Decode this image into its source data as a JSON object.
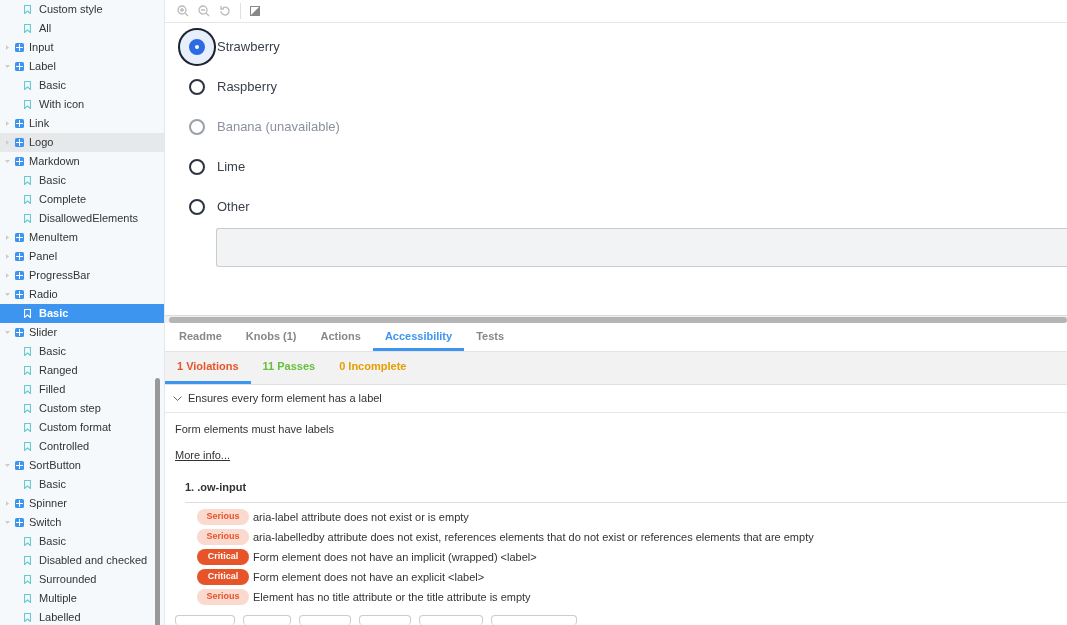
{
  "sidebar": {
    "items": [
      {
        "kind": "story",
        "label": "Custom style",
        "selected": false,
        "highlighted": false
      },
      {
        "kind": "story",
        "label": "All",
        "selected": false,
        "highlighted": false
      },
      {
        "kind": "component",
        "label": "Input",
        "expanded": false,
        "highlighted": false
      },
      {
        "kind": "component",
        "label": "Label",
        "expanded": true,
        "highlighted": false,
        "children": [
          {
            "kind": "story",
            "label": "Basic",
            "selected": false,
            "highlighted": false
          },
          {
            "kind": "story",
            "label": "With icon",
            "selected": false,
            "highlighted": false
          }
        ]
      },
      {
        "kind": "component",
        "label": "Link",
        "expanded": false,
        "highlighted": false
      },
      {
        "kind": "component",
        "label": "Logo",
        "expanded": false,
        "highlighted": true
      },
      {
        "kind": "component",
        "label": "Markdown",
        "expanded": true,
        "highlighted": false,
        "children": [
          {
            "kind": "story",
            "label": "Basic",
            "selected": false,
            "highlighted": false
          },
          {
            "kind": "story",
            "label": "Complete",
            "selected": false,
            "highlighted": false
          },
          {
            "kind": "story",
            "label": "DisallowedElements",
            "selected": false,
            "highlighted": false
          }
        ]
      },
      {
        "kind": "component",
        "label": "MenuItem",
        "expanded": false,
        "highlighted": false
      },
      {
        "kind": "component",
        "label": "Panel",
        "expanded": false,
        "highlighted": false
      },
      {
        "kind": "component",
        "label": "ProgressBar",
        "expanded": false,
        "highlighted": false
      },
      {
        "kind": "component",
        "label": "Radio",
        "expanded": true,
        "highlighted": false,
        "children": [
          {
            "kind": "story",
            "label": "Basic",
            "selected": true
          }
        ]
      },
      {
        "kind": "component",
        "label": "Slider",
        "expanded": true,
        "highlighted": false,
        "children": [
          {
            "kind": "story",
            "label": "Basic",
            "selected": false,
            "highlighted": false
          },
          {
            "kind": "story",
            "label": "Ranged",
            "selected": false,
            "highlighted": false
          },
          {
            "kind": "story",
            "label": "Filled",
            "selected": false,
            "highlighted": false
          },
          {
            "kind": "story",
            "label": "Custom step",
            "selected": false,
            "highlighted": false
          },
          {
            "kind": "story",
            "label": "Custom format",
            "selected": false,
            "highlighted": false
          },
          {
            "kind": "story",
            "label": "Controlled",
            "selected": false,
            "highlighted": false
          }
        ]
      },
      {
        "kind": "component",
        "label": "SortButton",
        "expanded": true,
        "highlighted": false,
        "children": [
          {
            "kind": "story",
            "label": "Basic",
            "selected": false,
            "highlighted": false
          }
        ]
      },
      {
        "kind": "component",
        "label": "Spinner",
        "expanded": false,
        "highlighted": false
      },
      {
        "kind": "component",
        "label": "Switch",
        "expanded": true,
        "highlighted": false,
        "children": [
          {
            "kind": "story",
            "label": "Basic",
            "selected": false,
            "highlighted": false
          },
          {
            "kind": "story",
            "label": "Disabled and checked",
            "selected": false,
            "highlighted": false
          },
          {
            "kind": "story",
            "label": "Surrounded",
            "selected": false,
            "highlighted": false
          },
          {
            "kind": "story",
            "label": "Multiple",
            "selected": false,
            "highlighted": false
          },
          {
            "kind": "story",
            "label": "Labelled",
            "selected": false,
            "highlighted": false
          }
        ]
      }
    ]
  },
  "radios": [
    {
      "label": "Strawberry",
      "selected": true,
      "disabled": false,
      "focused": true
    },
    {
      "label": "Raspberry",
      "selected": false,
      "disabled": false,
      "focused": false
    },
    {
      "label": "Banana (unavailable)",
      "selected": false,
      "disabled": true,
      "focused": false
    },
    {
      "label": "Lime",
      "selected": false,
      "disabled": false,
      "focused": false
    },
    {
      "label": "Other",
      "selected": false,
      "disabled": false,
      "focused": false
    }
  ],
  "addon_tabs": [
    {
      "label": "Readme",
      "selected": false
    },
    {
      "label": "Knobs (1)",
      "selected": false
    },
    {
      "label": "Actions",
      "selected": false
    },
    {
      "label": "Accessibility",
      "selected": true
    },
    {
      "label": "Tests",
      "selected": false
    }
  ],
  "a11y_tabs": [
    {
      "label": "1 Violations",
      "selected": true,
      "color": "#e8542a"
    },
    {
      "label": "11 Passes",
      "selected": false,
      "color": "#66bf3c"
    },
    {
      "label": "0 Incomplete",
      "selected": false,
      "color": "#e69d00"
    }
  ],
  "rule": {
    "title": "Ensures every form element has a label",
    "expanded": true,
    "description": "Form elements must have labels",
    "link": "More info...",
    "element": "1. .ow-input",
    "checks": [
      {
        "impact": "Serious",
        "message": "aria-label attribute does not exist or is empty"
      },
      {
        "impact": "Serious",
        "message": "aria-labelledby attribute does not exist, references elements that do not exist or references elements that are empty"
      },
      {
        "impact": "Critical",
        "message": "Form element does not have an implicit (wrapped) <label>"
      },
      {
        "impact": "Critical",
        "message": "Form element does not have an explicit <label>"
      },
      {
        "impact": "Serious",
        "message": "Element has no title attribute or the title attribute is empty"
      }
    ]
  }
}
